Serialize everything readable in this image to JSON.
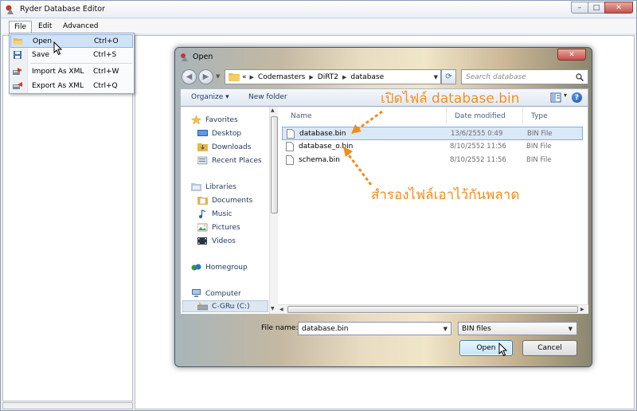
{
  "app": {
    "title": "Ryder Database Editor"
  },
  "window_controls": {
    "minimize": "–",
    "maximize": "□",
    "close": "✕"
  },
  "menubar": {
    "items": [
      "File",
      "Edit",
      "Advanced"
    ]
  },
  "file_menu": {
    "items": [
      {
        "label": "Open",
        "shortcut": "Ctrl+O",
        "icon": "folder-open-icon"
      },
      {
        "label": "Save",
        "shortcut": "Ctrl+S",
        "icon": "floppy-disk-icon"
      },
      {
        "label": "Import As XML",
        "shortcut": "Ctrl+W",
        "icon": "import-icon"
      },
      {
        "label": "Export As XML",
        "shortcut": "Ctrl+Q",
        "icon": "export-icon"
      }
    ]
  },
  "dialog": {
    "title": "Open",
    "close": "✕",
    "address": {
      "prefix": "«",
      "crumbs": [
        "Codemasters",
        "DiRT2",
        "database"
      ]
    },
    "search_placeholder": "Search database",
    "toolbar": {
      "organize": "Organize ▾",
      "new_folder": "New folder",
      "help": "?"
    },
    "nav": {
      "items": [
        {
          "label": "Favorites",
          "icon": "star-icon",
          "level": 0
        },
        {
          "label": "Desktop",
          "icon": "desktop-icon",
          "level": 1
        },
        {
          "label": "Downloads",
          "icon": "downloads-icon",
          "level": 1
        },
        {
          "label": "Recent Places",
          "icon": "recent-places-icon",
          "level": 1
        },
        {
          "label": "Libraries",
          "icon": "libraries-icon",
          "level": 0
        },
        {
          "label": "Documents",
          "icon": "documents-icon",
          "level": 1
        },
        {
          "label": "Music",
          "icon": "music-icon",
          "level": 1
        },
        {
          "label": "Pictures",
          "icon": "pictures-icon",
          "level": 1
        },
        {
          "label": "Videos",
          "icon": "videos-icon",
          "level": 1
        },
        {
          "label": "Homegroup",
          "icon": "homegroup-icon",
          "level": 0
        },
        {
          "label": "Computer",
          "icon": "computer-icon",
          "level": 0
        },
        {
          "label": "C-GRu (C:)",
          "icon": "drive-icon",
          "level": 1
        }
      ]
    },
    "columns": [
      "Name",
      "Date modified",
      "Type"
    ],
    "files": [
      {
        "name": "database.bin",
        "date": "13/6/2555 0:49",
        "type": "BIN File",
        "selected": true
      },
      {
        "name": "database_o.bin",
        "date": "8/10/2552 11:56",
        "type": "BIN File",
        "selected": false
      },
      {
        "name": "schema.bin",
        "date": "8/10/2552 11:56",
        "type": "BIN File",
        "selected": false
      }
    ],
    "file_name_label": "File name:",
    "file_name_value": "database.bin",
    "file_type_value": "BIN files",
    "open_button": "Open",
    "cancel_button": "Cancel"
  },
  "annotations": {
    "open_note": "เปิดไฟล์ database.bin",
    "backup_note": "สำรองไฟล์เอาไว้กันพลาด",
    "color": "#f28c1a"
  }
}
